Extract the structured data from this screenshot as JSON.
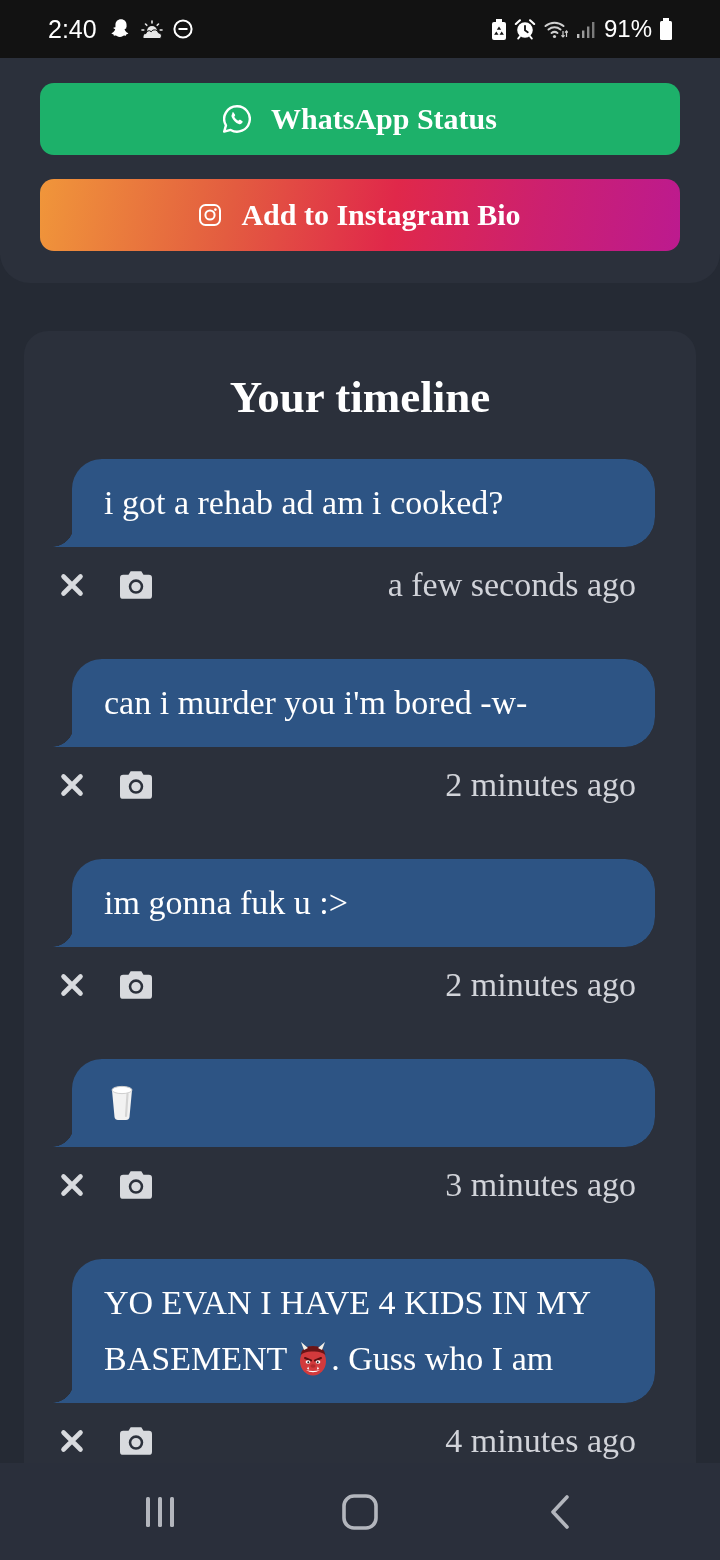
{
  "status_bar": {
    "time": "2:40",
    "battery": "91%"
  },
  "share_buttons": [
    {
      "kind": "whatsapp",
      "label": "WhatsApp Status"
    },
    {
      "kind": "instagram",
      "label": "Add to Instagram Bio"
    }
  ],
  "timeline": {
    "title": "Your timeline",
    "posts": [
      {
        "message": [
          {
            "kind": "text",
            "text": "i got a rehab ad am i cooked?"
          }
        ],
        "time": "a few seconds ago"
      },
      {
        "message": [
          {
            "kind": "text",
            "text": "can i murder you i'm bored -w-"
          }
        ],
        "time": "2 minutes ago"
      },
      {
        "message": [
          {
            "kind": "text",
            "text": "im gonna fuk u :>"
          }
        ],
        "time": "2 minutes ago"
      },
      {
        "message": [
          {
            "kind": "milk"
          }
        ],
        "time": "3 minutes ago"
      },
      {
        "message": [
          {
            "kind": "text",
            "text": "YO EVAN I HAVE 4 KIDS IN MY BASEMENT"
          },
          {
            "kind": "ogre"
          },
          {
            "kind": "text",
            "text": ". Guss who I am"
          }
        ],
        "time": "4 minutes ago"
      }
    ]
  }
}
